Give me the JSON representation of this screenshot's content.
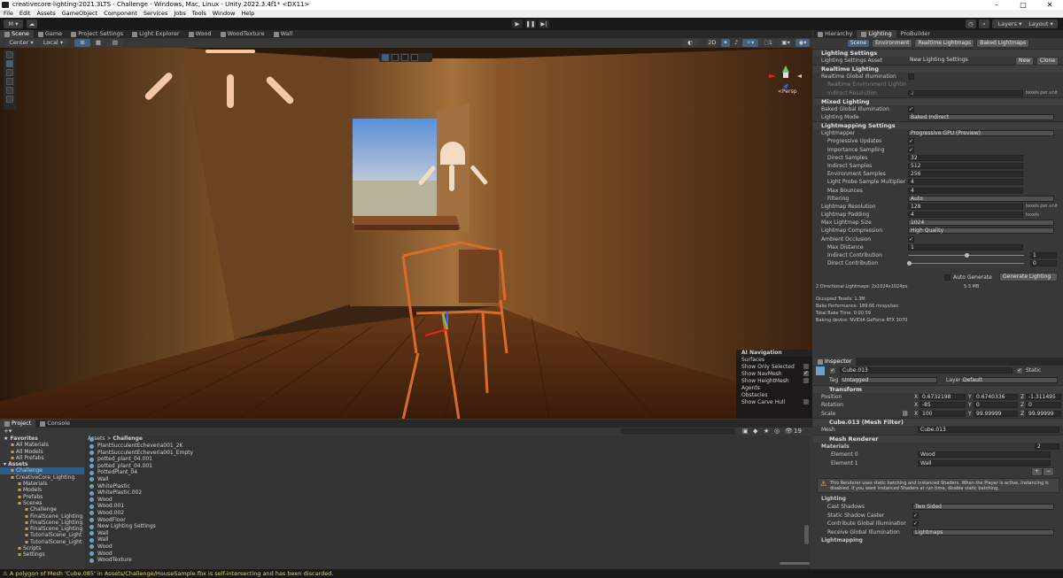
{
  "window": {
    "title": "creativecore-lighting-2021.3LTS - Challenge - Windows, Mac, Linux - Unity 2022.3.4f1* <DX11>"
  },
  "menu": [
    "File",
    "Edit",
    "Assets",
    "GameObject",
    "Component",
    "Services",
    "Jobs",
    "Tools",
    "Window",
    "Help"
  ],
  "toolbar": {
    "account_label": "M",
    "layers_label": "Layers",
    "layout_label": "Layout"
  },
  "scene_tabs": [
    "Scene",
    "Game",
    "Project Settings",
    "Light Explorer",
    "Wood",
    "WoodTexture",
    "Wall"
  ],
  "scene_toolbar": {
    "pivot": "Center",
    "space": "Local",
    "view_mode": "2D",
    "overlay_count": "1"
  },
  "scene": {
    "persp_label": "<Persp"
  },
  "nav_overlay": {
    "title": "AI Navigation",
    "surfaces": "Surfaces",
    "show_only_selected": "Show Only Selected",
    "show_navmesh": "Show NavMesh",
    "show_heightmesh": "Show HeightMesh",
    "agents": "Agents",
    "obstacles": "Obstacles",
    "show_carve_hull": "Show Carve Hull"
  },
  "right_tabs": [
    "Hierarchy",
    "Lighting",
    "ProBuilder"
  ],
  "lighting": {
    "subtabs": [
      "Scene",
      "Environment",
      "Realtime Lightmaps",
      "Baked Lightmaps"
    ],
    "settings_section": "Lighting Settings",
    "settings_asset_label": "Lighting Settings Asset",
    "settings_asset_value": "New Lighting Settings",
    "new_btn": "New",
    "clone_btn": "Clone",
    "realtime_section": "Realtime Lighting",
    "realtime_gi": "Realtime Global Illumination",
    "realtime_env": "Realtime Environment Lighting",
    "indirect_res": "Indirect Resolution",
    "indirect_res_val": "2",
    "texels_per_unit": "texels per unit",
    "mixed_section": "Mixed Lighting",
    "baked_gi": "Baked Global Illumination",
    "lighting_mode": "Lighting Mode",
    "lighting_mode_val": "Baked Indirect",
    "lightmapping_section": "Lightmapping Settings",
    "rows": [
      {
        "label": "Lightmapper",
        "value": "Progressive GPU (Preview)",
        "kind": "sel",
        "indent": 0
      },
      {
        "label": "Progressive Updates",
        "value": "✓",
        "kind": "chk",
        "indent": 1
      },
      {
        "label": "Importance Sampling",
        "value": "✓",
        "kind": "chk",
        "indent": 1
      },
      {
        "label": "Direct Samples",
        "value": "32",
        "kind": "num",
        "indent": 1
      },
      {
        "label": "Indirect Samples",
        "value": "512",
        "kind": "num",
        "indent": 1
      },
      {
        "label": "Environment Samples",
        "value": "256",
        "kind": "num",
        "indent": 1
      },
      {
        "label": "Light Probe Sample Multiplier",
        "value": "4",
        "kind": "num",
        "indent": 1
      },
      {
        "label": "Max Bounces",
        "value": "4",
        "kind": "num",
        "indent": 1
      },
      {
        "label": "Filtering",
        "value": "Auto",
        "kind": "sel",
        "indent": 1
      },
      {
        "label": "Lightmap Resolution",
        "value": "128",
        "kind": "num",
        "indent": 0,
        "unit": "texels per unit"
      },
      {
        "label": "Lightmap Padding",
        "value": "4",
        "kind": "num",
        "indent": 0,
        "unit": "texels"
      },
      {
        "label": "Max Lightmap Size",
        "value": "1024",
        "kind": "sel",
        "indent": 0
      },
      {
        "label": "Lightmap Compression",
        "value": "High Quality",
        "kind": "sel",
        "indent": 0
      },
      {
        "label": "Ambient Occlusion",
        "value": "✓",
        "kind": "chk",
        "indent": 0
      },
      {
        "label": "Max Distance",
        "value": "1",
        "kind": "num",
        "indent": 1
      },
      {
        "label": "Indirect Contribution",
        "value": "1",
        "kind": "slider",
        "indent": 1
      },
      {
        "label": "Direct Contribution",
        "value": "0",
        "kind": "slider",
        "indent": 1
      }
    ],
    "auto_generate": "Auto Generate",
    "generate_btn": "Generate Lighting",
    "stats": {
      "lightmaps": "2 Directional Lightmaps: 2x1024x1024px",
      "size": "5.3 MB",
      "occupied": "Occupied Texels: 1.3M",
      "bake_perf": "Bake Performance: 189.66 mrays/sec",
      "bake_time": "Total Bake Time: 0:00:59",
      "device": "Baking device: NVIDIA GeForce RTX 3070"
    }
  },
  "inspector": {
    "tab": "Inspector",
    "object_name": "Cube.013",
    "static_label": "Static",
    "tag_label": "Tag",
    "tag_value": "Untagged",
    "layer_label": "Layer",
    "layer_value": "Default",
    "transform": "Transform",
    "position_label": "Position",
    "pos": {
      "x": "0.6732198",
      "y": "0.6740336",
      "z": "-1.311495"
    },
    "rotation_label": "Rotation",
    "rot": {
      "x": "-85",
      "y": "0",
      "z": "0"
    },
    "scale_label": "Scale",
    "scl": {
      "x": "100",
      "y": "99.99999",
      "z": "99.99999"
    },
    "mesh_filter": "Cube.013 (Mesh Filter)",
    "mesh_label": "Mesh",
    "mesh_value": "Cube.013",
    "mesh_renderer": "Mesh Renderer",
    "materials": "Materials",
    "materials_count": "2",
    "element0": "Element 0",
    "element0_val": "Wood",
    "element1": "Element 1",
    "element1_val": "Wall",
    "warning": "This Renderer uses static batching and instanced Shaders. When the Player is active, instancing is disabled. If you want instanced Shaders at run time, disable static batching.",
    "lighting": "Lighting",
    "cast_shadows": "Cast Shadows",
    "cast_shadows_val": "Two Sided",
    "static_shadow": "Static Shadow Caster",
    "contribute_gi": "Contribute Global Illumination",
    "receive_gi": "Receive Global Illumination",
    "receive_gi_val": "Lightmaps",
    "lightmapping": "Lightmapping"
  },
  "project": {
    "tabs": [
      "Project",
      "Console"
    ],
    "breadcrumb": [
      "Assets",
      "Challenge"
    ],
    "hidden_count": "19",
    "tree": [
      {
        "label": "Favorites",
        "lvl": 0,
        "bold": true
      },
      {
        "label": "All Materials",
        "lvl": 1
      },
      {
        "label": "All Models",
        "lvl": 1
      },
      {
        "label": "All Prefabs",
        "lvl": 1
      },
      {
        "label": "Assets",
        "lvl": 0,
        "bold": true
      },
      {
        "label": "Challenge",
        "lvl": 1,
        "sel": true
      },
      {
        "label": "CreativeCore_Lighting",
        "lvl": 1
      },
      {
        "label": "Materials",
        "lvl": 2
      },
      {
        "label": "Models",
        "lvl": 2
      },
      {
        "label": "Prefabs",
        "lvl": 2
      },
      {
        "label": "Scenes",
        "lvl": 2
      },
      {
        "label": "Challenge",
        "lvl": 3
      },
      {
        "label": "FinalScene_Lighting",
        "lvl": 3
      },
      {
        "label": "FinalScene_Lighting",
        "lvl": 3
      },
      {
        "label": "FinalScene_Lighting",
        "lvl": 3
      },
      {
        "label": "TutorialScene_Light",
        "lvl": 3
      },
      {
        "label": "TutorialScene_Light",
        "lvl": 3
      },
      {
        "label": "Scripts",
        "lvl": 2
      },
      {
        "label": "Settings",
        "lvl": 2
      }
    ],
    "files": [
      "PlantSucculentEcheveria001_2K",
      "PlantSucculentEcheveria001_Empty",
      "potted_plant_04.001",
      "potted_plant_04.001",
      "PottedPlant_04",
      "Wall",
      "WhitePlastic",
      "WhitePlastic.002",
      "Wood",
      "Wood.001",
      "Wood.002",
      "WoodFloor",
      "New Lighting Settings",
      "Wall",
      "Wall",
      "Wood",
      "Wood",
      "WoodTexture"
    ]
  },
  "status": "A polygon of Mesh 'Cube.085' in Assets/Challenge/HouseSample.fbx is self-intersecting and has been discarded."
}
